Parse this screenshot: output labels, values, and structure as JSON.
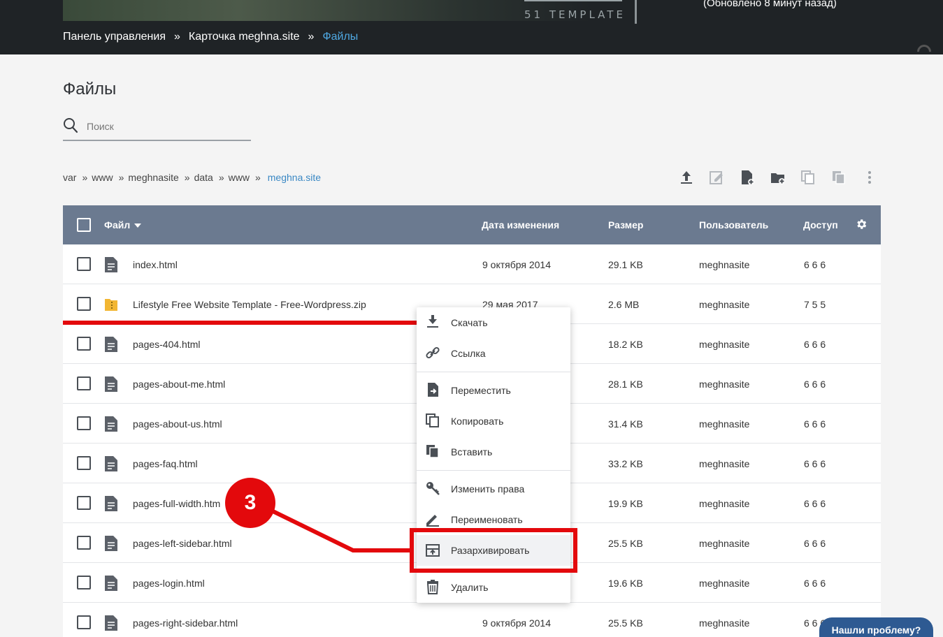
{
  "header": {
    "banner_logo": "51 TEMPLATE",
    "update_note": "(Обновлено 8 минут назад)",
    "breadcrumb": [
      "Панель управления",
      "Карточка meghna.site",
      "Файлы"
    ],
    "breadcrumb_sep": "»"
  },
  "page": {
    "title": "Файлы",
    "search_placeholder": "Поиск"
  },
  "path": {
    "segments": [
      "var",
      "www",
      "meghnasite",
      "data",
      "www"
    ],
    "current": "meghna.site",
    "sep": "»"
  },
  "toolbar": {
    "icons": [
      "upload-icon",
      "edit-file-icon",
      "new-file-icon",
      "new-folder-icon",
      "copy-icon",
      "paste-icon",
      "more-vertical-icon"
    ]
  },
  "table": {
    "headers": {
      "name": "Файл",
      "date": "Дата изменения",
      "size": "Размер",
      "user": "Пользователь",
      "access": "Доступ"
    },
    "rows": [
      {
        "name": "index.html",
        "date": "9 октября 2014",
        "size": "29.1 KB",
        "user": "meghnasite",
        "access": "6 6 6",
        "type": "file"
      },
      {
        "name": "Lifestyle Free Website Template - Free-Wordpress.zip",
        "date": "29 мая 2017",
        "size": "2.6 MB",
        "user": "meghnasite",
        "access": "7 5 5",
        "type": "zip"
      },
      {
        "name": "pages-404.html",
        "date": "",
        "size": "18.2 KB",
        "user": "meghnasite",
        "access": "6 6 6",
        "type": "file"
      },
      {
        "name": "pages-about-me.html",
        "date": "",
        "size": "28.1 KB",
        "user": "meghnasite",
        "access": "6 6 6",
        "type": "file"
      },
      {
        "name": "pages-about-us.html",
        "date": "",
        "size": "31.4 KB",
        "user": "meghnasite",
        "access": "6 6 6",
        "type": "file"
      },
      {
        "name": "pages-faq.html",
        "date": "",
        "size": "33.2 KB",
        "user": "meghnasite",
        "access": "6 6 6",
        "type": "file"
      },
      {
        "name": "pages-full-width.htm",
        "date": "",
        "size": "19.9 KB",
        "user": "meghnasite",
        "access": "6 6 6",
        "type": "file"
      },
      {
        "name": "pages-left-sidebar.html",
        "date": "",
        "size": "25.5 KB",
        "user": "meghnasite",
        "access": "6 6 6",
        "type": "file"
      },
      {
        "name": "pages-login.html",
        "date": "",
        "size": "19.6 KB",
        "user": "meghnasite",
        "access": "6 6 6",
        "type": "file"
      },
      {
        "name": "pages-right-sidebar.html",
        "date": "9 октября 2014",
        "size": "25.5 KB",
        "user": "meghnasite",
        "access": "6 6 6",
        "type": "file"
      }
    ]
  },
  "context_menu": {
    "items": [
      {
        "label": "Скачать",
        "icon": "download-icon"
      },
      {
        "label": "Ссылка",
        "icon": "link-icon"
      },
      {
        "label": "Переместить",
        "icon": "move-file-icon"
      },
      {
        "label": "Копировать",
        "icon": "copy-icon"
      },
      {
        "label": "Вставить",
        "icon": "paste-icon"
      },
      {
        "label": "Изменить права",
        "icon": "key-icon"
      },
      {
        "label": "Переименовать",
        "icon": "rename-icon"
      },
      {
        "label": "Разархивировать",
        "icon": "unarchive-icon"
      },
      {
        "label": "Удалить",
        "icon": "trash-icon"
      }
    ]
  },
  "annotation": {
    "step_number": "3",
    "color": "#e3090c"
  },
  "help_button": "Нашли проблему?",
  "colors": {
    "table_header": "#6b7a90",
    "link_blue": "#3a88c4",
    "breadcrumb_active": "#4fa9e3",
    "annotation_red": "#e3090c",
    "help_button": "#2e5a92"
  }
}
